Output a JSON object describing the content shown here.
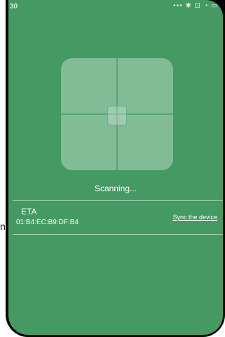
{
  "status_bar": {
    "time": "30",
    "icons": [
      "more-dots-icon",
      "bluetooth-icon",
      "alarm-icon",
      "wifi-icon",
      "battery-icon"
    ]
  },
  "scanner": {
    "status_text": "Scanning..."
  },
  "device": {
    "name": "ETA",
    "mac": "01:B4:EC:B9:DF:B4",
    "action_label": "Sync the device"
  },
  "outside_text": "n",
  "colors": {
    "background": "#449a62",
    "scan_box": "#a6cfb7",
    "text": "#ffffff"
  }
}
